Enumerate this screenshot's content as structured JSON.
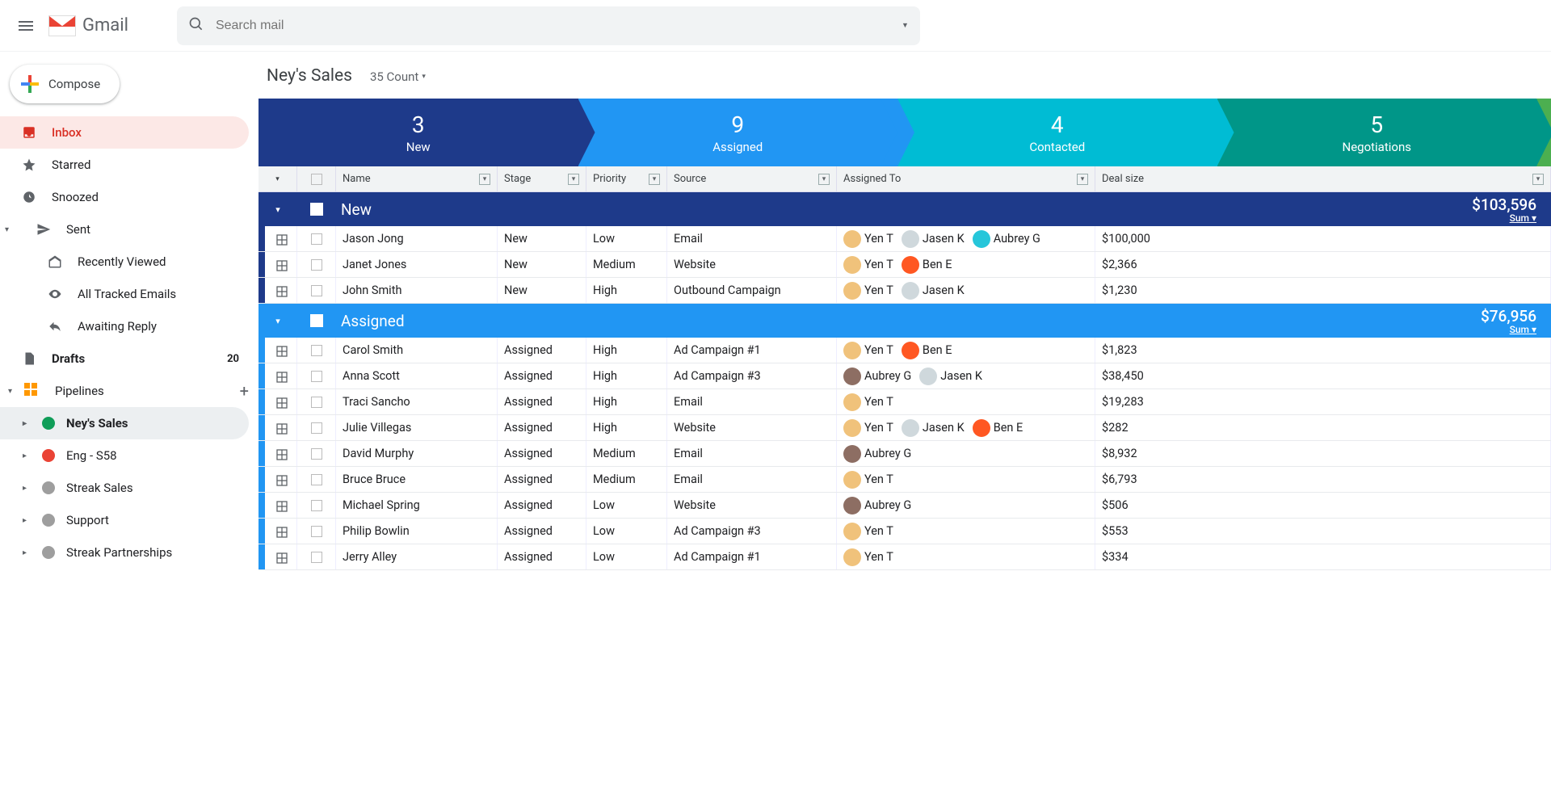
{
  "header": {
    "app_name": "Gmail",
    "search_placeholder": "Search mail"
  },
  "sidebar": {
    "compose_label": "Compose",
    "items": [
      {
        "label": "Inbox",
        "icon": "inbox",
        "active": true
      },
      {
        "label": "Starred",
        "icon": "star"
      },
      {
        "label": "Snoozed",
        "icon": "clock"
      },
      {
        "label": "Sent",
        "icon": "send",
        "expandable": true
      }
    ],
    "sent_children": [
      {
        "label": "Recently Viewed",
        "icon": "open-mail"
      },
      {
        "label": "All Tracked Emails",
        "icon": "eye"
      },
      {
        "label": "Awaiting Reply",
        "icon": "reply"
      }
    ],
    "drafts": {
      "label": "Drafts",
      "count": "20"
    },
    "pipelines_label": "Pipelines",
    "pipelines": [
      {
        "label": "Ney's Sales",
        "color": "#0f9d58",
        "selected": true
      },
      {
        "label": "Eng - S58",
        "color": "#ea4335"
      },
      {
        "label": "Streak Sales",
        "color": "#9e9e9e"
      },
      {
        "label": "Support",
        "color": "#9e9e9e"
      },
      {
        "label": "Streak Partnerships",
        "color": "#9e9e9e"
      }
    ]
  },
  "content": {
    "title": "Ney's Sales",
    "count_label": "35 Count",
    "stages": [
      {
        "count": "3",
        "label": "New",
        "color": "#1e3a8a"
      },
      {
        "count": "9",
        "label": "Assigned",
        "color": "#2196f3"
      },
      {
        "count": "4",
        "label": "Contacted",
        "color": "#00bcd4"
      },
      {
        "count": "5",
        "label": "Negotiations",
        "color": "#009688"
      }
    ],
    "stage_tail_color": "#4caf50",
    "columns": [
      "Name",
      "Stage",
      "Priority",
      "Source",
      "Assigned To",
      "Deal size"
    ],
    "groups": [
      {
        "label": "New",
        "color": "#1e3a8a",
        "sum": "$103,596",
        "sum_label": "Sum",
        "rows": [
          {
            "name": "Jason Jong",
            "stage": "New",
            "priority": "Low",
            "source": "Email",
            "assigned": [
              {
                "n": "Yen T",
                "c": "#f0c27b"
              },
              {
                "n": "Jasen K",
                "c": "#cfd8dc"
              },
              {
                "n": "Aubrey G",
                "c": "#26c6da"
              }
            ],
            "deal": "$100,000"
          },
          {
            "name": "Janet Jones",
            "stage": "New",
            "priority": "Medium",
            "source": "Website",
            "assigned": [
              {
                "n": "Yen T",
                "c": "#f0c27b"
              },
              {
                "n": "Ben E",
                "c": "#ff5722"
              }
            ],
            "deal": "$2,366"
          },
          {
            "name": "John Smith",
            "stage": "New",
            "priority": "High",
            "source": "Outbound Campaign",
            "assigned": [
              {
                "n": "Yen T",
                "c": "#f0c27b"
              },
              {
                "n": "Jasen K",
                "c": "#cfd8dc"
              }
            ],
            "deal": "$1,230"
          }
        ]
      },
      {
        "label": "Assigned",
        "color": "#2196f3",
        "sum": "$76,956",
        "sum_label": "Sum",
        "rows": [
          {
            "name": "Carol Smith",
            "stage": "Assigned",
            "priority": "High",
            "source": "Ad Campaign #1",
            "assigned": [
              {
                "n": "Yen T",
                "c": "#f0c27b"
              },
              {
                "n": "Ben E",
                "c": "#ff5722"
              }
            ],
            "deal": "$1,823"
          },
          {
            "name": "Anna Scott",
            "stage": "Assigned",
            "priority": "High",
            "source": "Ad Campaign #3",
            "assigned": [
              {
                "n": "Aubrey G",
                "c": "#8d6e63"
              },
              {
                "n": "Jasen K",
                "c": "#cfd8dc"
              }
            ],
            "deal": "$38,450"
          },
          {
            "name": "Traci Sancho",
            "stage": "Assigned",
            "priority": "High",
            "source": "Email",
            "assigned": [
              {
                "n": "Yen T",
                "c": "#f0c27b"
              }
            ],
            "deal": "$19,283"
          },
          {
            "name": "Julie Villegas",
            "stage": "Assigned",
            "priority": "High",
            "source": "Website",
            "assigned": [
              {
                "n": "Yen T",
                "c": "#f0c27b"
              },
              {
                "n": "Jasen K",
                "c": "#cfd8dc"
              },
              {
                "n": "Ben E",
                "c": "#ff5722"
              }
            ],
            "deal": "$282"
          },
          {
            "name": "David Murphy",
            "stage": "Assigned",
            "priority": "Medium",
            "source": "Email",
            "assigned": [
              {
                "n": "Aubrey G",
                "c": "#8d6e63"
              }
            ],
            "deal": "$8,932"
          },
          {
            "name": "Bruce Bruce",
            "stage": "Assigned",
            "priority": "Medium",
            "source": "Email",
            "assigned": [
              {
                "n": "Yen T",
                "c": "#f0c27b"
              }
            ],
            "deal": "$6,793"
          },
          {
            "name": "Michael Spring",
            "stage": "Assigned",
            "priority": "Low",
            "source": "Website",
            "assigned": [
              {
                "n": "Aubrey G",
                "c": "#8d6e63"
              }
            ],
            "deal": "$506"
          },
          {
            "name": "Philip Bowlin",
            "stage": "Assigned",
            "priority": "Low",
            "source": "Ad Campaign #3",
            "assigned": [
              {
                "n": "Yen T",
                "c": "#f0c27b"
              }
            ],
            "deal": "$553"
          },
          {
            "name": "Jerry Alley",
            "stage": "Assigned",
            "priority": "Low",
            "source": "Ad Campaign #1",
            "assigned": [
              {
                "n": "Yen T",
                "c": "#f0c27b"
              }
            ],
            "deal": "$334"
          }
        ]
      }
    ]
  }
}
